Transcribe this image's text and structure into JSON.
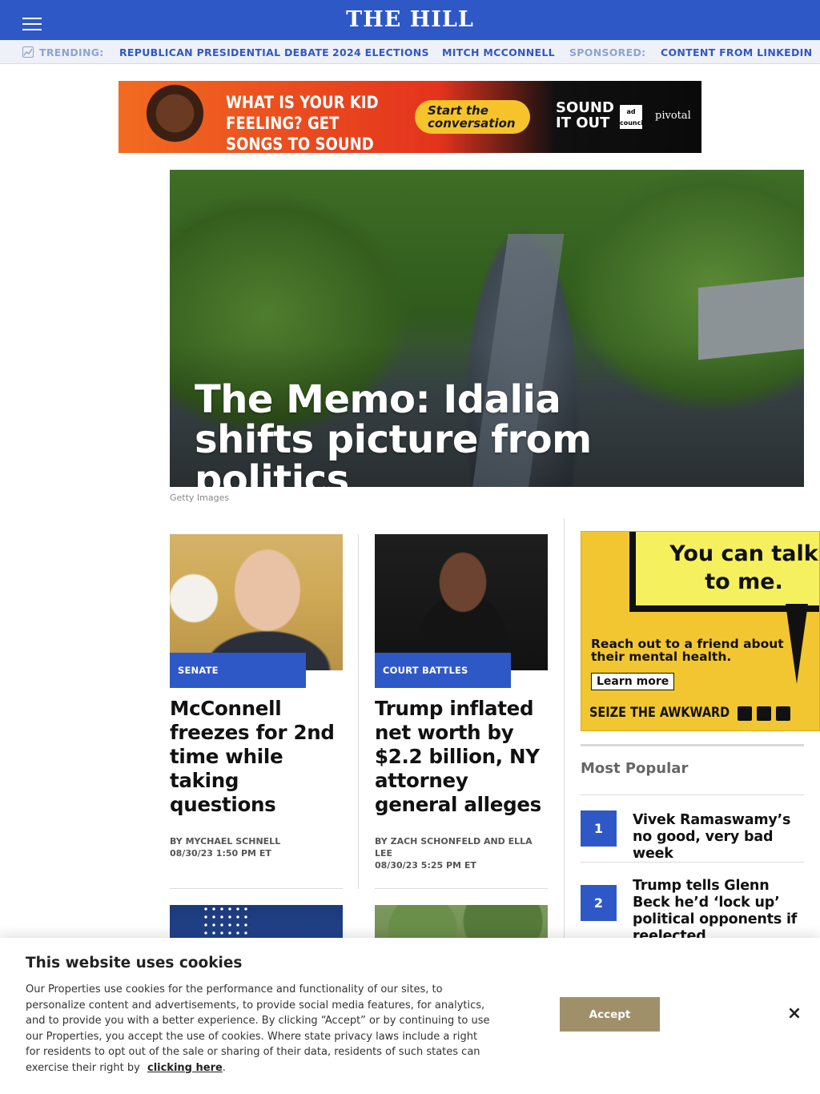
{
  "header": {
    "brand": "THE HILL",
    "menu_icon": "hamburger-menu-icon"
  },
  "trending": {
    "icon": "trending-chart-icon",
    "label": "TRENDING:",
    "links": [
      "REPUBLICAN PRESIDENTIAL DEBATE",
      "2024 ELECTIONS",
      "MITCH MCCONNELL"
    ],
    "sponsored_label": "SPONSORED:",
    "sponsored_link": "CONTENT FROM LINKEDIN"
  },
  "top_ad": {
    "headline": "WHAT IS YOUR KID FEELING? GET SONGS TO SOUND IT OUT.",
    "cta": "Start the conversation",
    "brand1": "SOUND IT OUT",
    "brand2": "ad council",
    "brand3": "pivotal"
  },
  "hero": {
    "title": "The Memo: Idalia shifts picture from politics",
    "caption": "Getty Images"
  },
  "articles": [
    {
      "tag": "SENATE",
      "title": "McConnell freezes for 2nd time while taking questions",
      "by_prefix": "BY",
      "author": "MYCHAEL SCHNELL",
      "date": "08/30/23 1:50 PM ET"
    },
    {
      "tag": "COURT BATTLES",
      "title": "Trump inflated net worth by $2.2 billion, NY attorney general alleges",
      "by_prefix": "BY",
      "author": "ZACH SCHONFELD AND ELLA LEE",
      "date": "08/30/23 5:25 PM ET"
    }
  ],
  "side_ad": {
    "headline": "You can talk to me.",
    "sub": "Reach out to a friend about their mental health.",
    "button": "Learn more",
    "footer": "SEIZE THE AWKWARD"
  },
  "most_popular": {
    "title": "Most Popular",
    "items": [
      {
        "rank": "1",
        "title": "Vivek Ramaswamy’s no good, very bad week"
      },
      {
        "rank": "2",
        "title": "Trump tells Glenn Beck he’d ‘lock up’ political opponents if reelected"
      }
    ]
  },
  "cookie": {
    "title": "This website uses cookies",
    "body": "Our Properties use cookies for the performance and functionality of our sites, to personalize content and advertisements, to provide social media features, for analytics, and to provide you with a better experience. By clicking “Accept” or by continuing to use our Properties, you accept the use of cookies. Where state privacy laws include a right for residents to opt out of the sale or sharing of their data, residents of such states can exercise their right by",
    "link": "clicking here",
    "link_suffix": ".",
    "accept": "Accept",
    "close": "×"
  },
  "colors": {
    "brand_blue": "#2f58c7",
    "accept_button": "#a0906a",
    "ad_yellow": "#f2c630"
  }
}
